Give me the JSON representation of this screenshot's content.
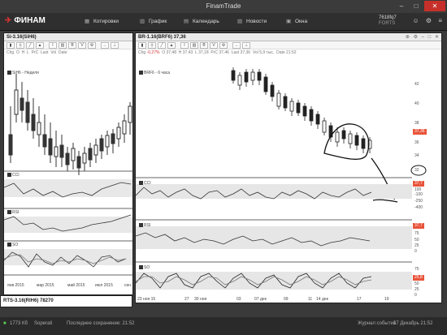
{
  "window": {
    "title": "FinamTrade"
  },
  "toolbar": {
    "logo": "ФИНАМ",
    "items": [
      {
        "label": "Котировки",
        "icon": "quotes-icon"
      },
      {
        "label": "График",
        "icon": "chart-icon"
      },
      {
        "label": "Календарь",
        "icon": "calendar-icon"
      },
      {
        "label": "Новости",
        "icon": "news-icon"
      },
      {
        "label": "Окна",
        "icon": "windows-icon"
      }
    ],
    "account_id": "7618fq7",
    "account_sub": "FORTS"
  },
  "left_panel": {
    "title": "Si-3.16(SiH6)",
    "legend": "SiH6 - Неделя",
    "info_fields": [
      "Chg",
      "O",
      "H",
      "L",
      "PrC",
      "Last",
      "Vol",
      "Date"
    ],
    "sections": [
      "CCI",
      "RSI",
      "SO"
    ],
    "x_labels": [
      "янв 2015",
      "мар 2015",
      "май 2015",
      "июл 2015",
      "сен"
    ]
  },
  "right_panel": {
    "title": "BR-1.16(BRF6) 37,36",
    "legend": "BRF6 - 6 часа",
    "info": {
      "chg_label": "Chg",
      "chg": "-0,27%",
      "o_label": "O",
      "o": "37,48",
      "h_label": "H",
      "h": "37,43",
      "l_label": "L",
      "l": "37,18",
      "prc_label": "PrC",
      "prc": "37,46",
      "last_label": "Last",
      "last": "37,36",
      "vol_label": "Vol",
      "vol": "5,9 тыс.",
      "date_label": "Date",
      "date": "21:52"
    },
    "price_axis": [
      "42",
      "40",
      "38",
      "36",
      "34",
      "32"
    ],
    "price_tag": "37,36",
    "cci": {
      "title": "CCI",
      "tag": "37,7",
      "axis": [
        "100",
        "-100",
        "-250",
        "-400"
      ]
    },
    "rsi": {
      "title": "RSI",
      "tag": "37,7",
      "axis": [
        "75",
        "50",
        "25",
        "0"
      ]
    },
    "so": {
      "title": "SO",
      "tag": "25,8",
      "axis": [
        "75",
        "50",
        "25",
        "0"
      ]
    },
    "x_labels": [
      "23 ноя 15",
      "27",
      "30 ноя",
      "03",
      "07 дек",
      "09",
      "11",
      "14 дек",
      "17",
      "19"
    ]
  },
  "bottom_left": {
    "title": "RTS-3.16(RIH6) 78270"
  },
  "status": {
    "memory": "1773 Кб",
    "server": "Soperati",
    "saved": "Последнее сохранение: 21:52",
    "journal": "Журнал событий",
    "date": "17 Декабрь 21:52"
  },
  "colors": {
    "accent": "#e8533a",
    "titlebar": "#3b3b3b",
    "close": "#c7302a"
  }
}
